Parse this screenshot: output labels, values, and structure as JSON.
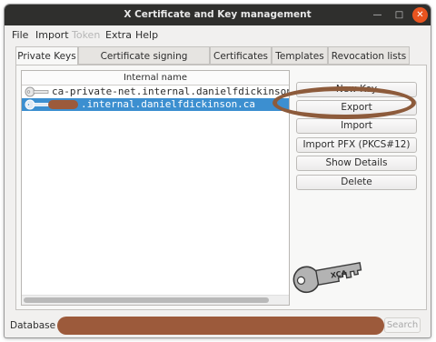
{
  "window": {
    "title": "X Certificate and Key management",
    "controls": {
      "minimize": "—",
      "maximize": "□",
      "close": "✕"
    }
  },
  "menu": [
    "File",
    "Import",
    "Token",
    "Extra",
    "Help"
  ],
  "tabs": [
    "Private Keys",
    "Certificate signing requests",
    "Certificates",
    "Templates",
    "Revocation lists"
  ],
  "key_list": {
    "header": "Internal name",
    "rows": [
      {
        "text": "ca-private-net.internal.danielfdickinson",
        "selected": false
      },
      {
        "text": ".internal.danielfdickinson.ca",
        "selected": true
      }
    ]
  },
  "buttons": [
    "New Key",
    "Export",
    "Import",
    "Import PFX (PKCS#12)",
    "Show Details",
    "Delete"
  ],
  "status": {
    "database_label": "Database",
    "search_label": "Search"
  },
  "key_image": {
    "text": "XCA"
  },
  "colors": {
    "selection": "#3c8fd0",
    "close": "#e9541f",
    "annotation": "#8d5b3b",
    "redaction": "#9c5a3b"
  }
}
